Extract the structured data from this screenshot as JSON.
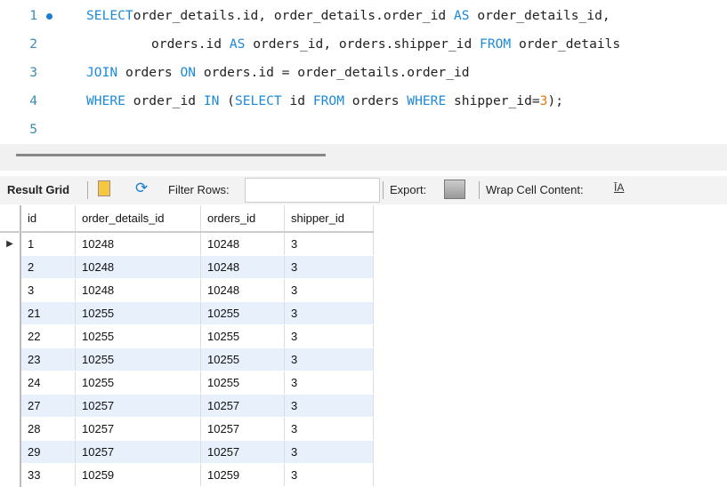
{
  "editor": {
    "lines": [
      {
        "n": "1",
        "tokens": [
          [
            "kw",
            "SELECT"
          ],
          [
            "",
            "order_details.id, order_details.order_id "
          ],
          [
            "kw",
            "AS"
          ],
          [
            "",
            " order_details_id,"
          ]
        ],
        "indent": false,
        "dot": true
      },
      {
        "n": "2",
        "tokens": [
          [
            "",
            "orders.id "
          ],
          [
            "kw",
            "AS"
          ],
          [
            "",
            " orders_id, orders.shipper_id "
          ],
          [
            "kw",
            "FROM"
          ],
          [
            "",
            " order_details"
          ]
        ],
        "indent": true
      },
      {
        "n": "3",
        "tokens": [
          [
            "kw",
            "JOIN"
          ],
          [
            "",
            " orders "
          ],
          [
            "kw",
            "ON"
          ],
          [
            "",
            " orders.id = order_details.order_id"
          ]
        ],
        "indent": false
      },
      {
        "n": "4",
        "tokens": [
          [
            "kw",
            "WHERE"
          ],
          [
            "",
            " order_id "
          ],
          [
            "kw",
            "IN"
          ],
          [
            "",
            " ("
          ],
          [
            "kw",
            "SELECT"
          ],
          [
            "",
            " id "
          ],
          [
            "kw",
            "FROM"
          ],
          [
            "",
            " orders "
          ],
          [
            "kw",
            "WHERE"
          ],
          [
            "",
            " shipper_id="
          ],
          [
            "num",
            "3"
          ],
          [
            "",
            ");"
          ]
        ],
        "indent": false
      },
      {
        "n": "5",
        "tokens": [],
        "indent": false
      }
    ]
  },
  "toolbar": {
    "result_grid": "Result Grid",
    "filter_rows": "Filter Rows:",
    "filter_value": "",
    "export": "Export:",
    "wrap": "Wrap Cell Content:"
  },
  "grid": {
    "columns": [
      "id",
      "order_details_id",
      "orders_id",
      "shipper_id"
    ],
    "rows": [
      [
        "1",
        "10248",
        "10248",
        "3"
      ],
      [
        "2",
        "10248",
        "10248",
        "3"
      ],
      [
        "3",
        "10248",
        "10248",
        "3"
      ],
      [
        "21",
        "10255",
        "10255",
        "3"
      ],
      [
        "22",
        "10255",
        "10255",
        "3"
      ],
      [
        "23",
        "10255",
        "10255",
        "3"
      ],
      [
        "24",
        "10255",
        "10255",
        "3"
      ],
      [
        "27",
        "10257",
        "10257",
        "3"
      ],
      [
        "28",
        "10257",
        "10257",
        "3"
      ],
      [
        "29",
        "10257",
        "10257",
        "3"
      ],
      [
        "33",
        "10259",
        "10259",
        "3"
      ]
    ]
  }
}
